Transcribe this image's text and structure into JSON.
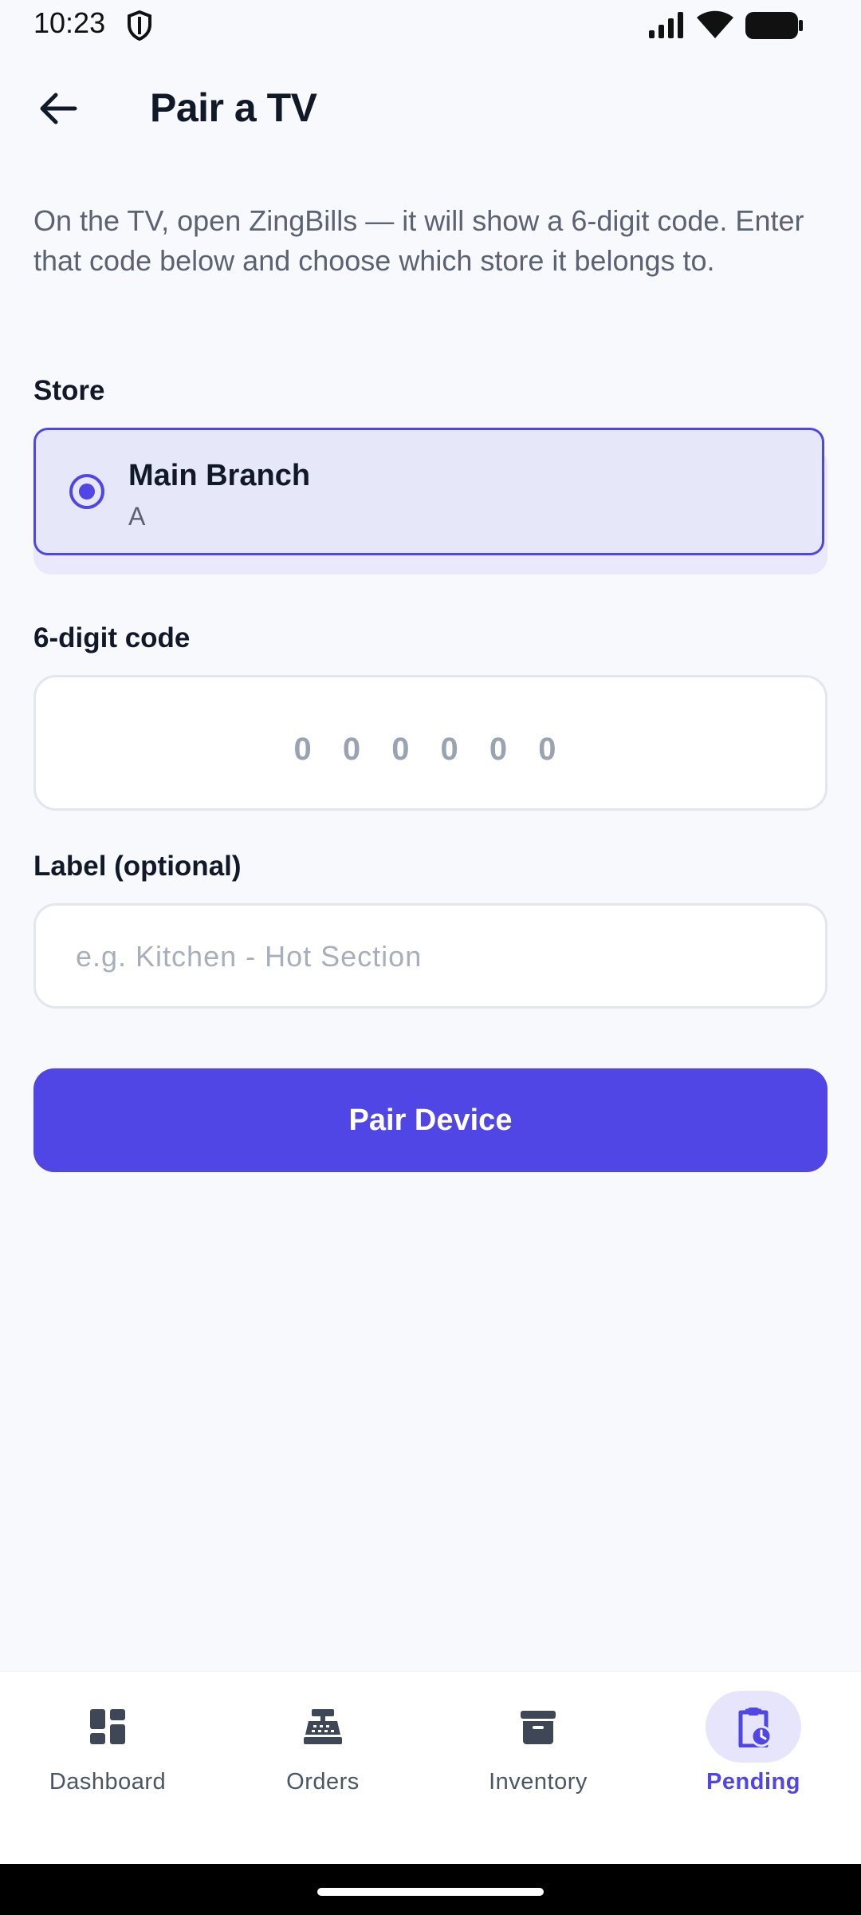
{
  "status_bar": {
    "time": "10:23"
  },
  "header": {
    "title": "Pair a TV"
  },
  "description": "On the TV, open ZingBills — it will show a 6-digit code. Enter that code below and choose which store it belongs to.",
  "store_section": {
    "label": "Store",
    "selected_store": {
      "name": "Main Branch",
      "subtitle": "A"
    }
  },
  "code_section": {
    "label": "6-digit code",
    "value": "",
    "placeholder": "0 0 0 0 0 0"
  },
  "label_section": {
    "label": "Label (optional)",
    "value": "",
    "placeholder": "e.g. Kitchen - Hot Section"
  },
  "pair_button": {
    "label": "Pair Device"
  },
  "bottom_nav": {
    "items": [
      {
        "label": "Dashboard",
        "icon": "dashboard-icon",
        "active": false
      },
      {
        "label": "Orders",
        "icon": "cash-register-icon",
        "active": false
      },
      {
        "label": "Inventory",
        "icon": "archive-box-icon",
        "active": false
      },
      {
        "label": "Pending",
        "icon": "clipboard-clock-icon",
        "active": true
      }
    ]
  },
  "colors": {
    "accent": "#4f46e5",
    "background": "#f8f9fc",
    "selected_bg": "#e7e7fa"
  }
}
